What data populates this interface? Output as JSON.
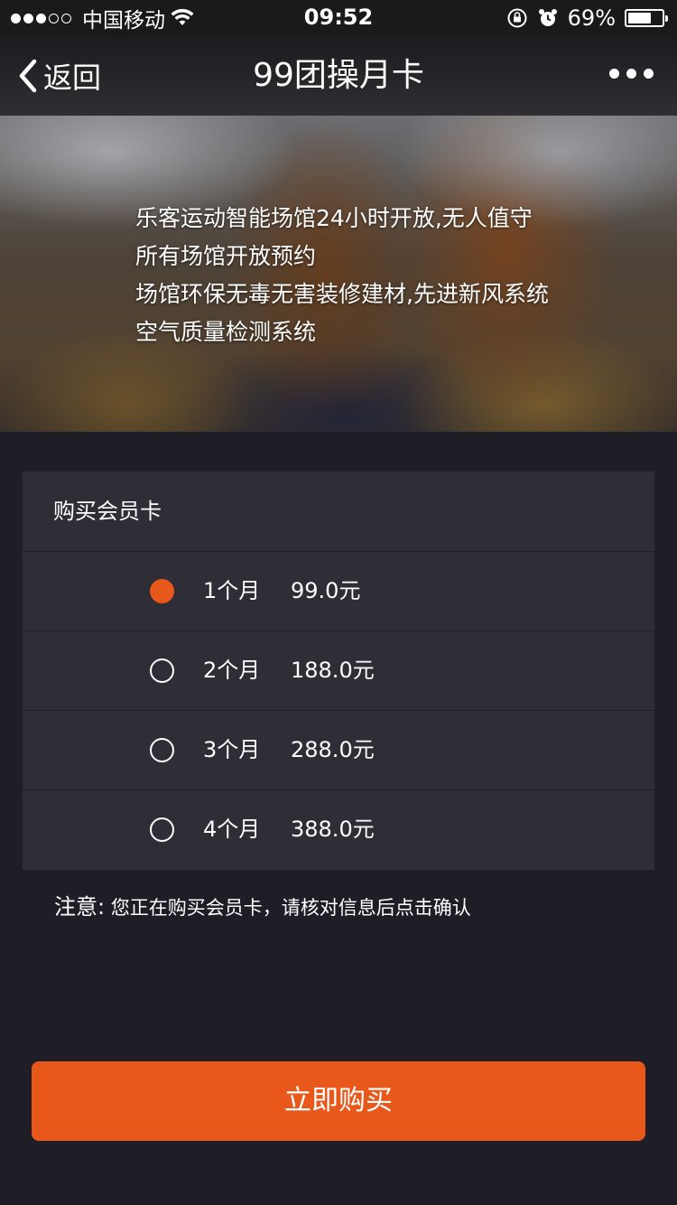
{
  "status_bar": {
    "signal_full": 3,
    "signal_empty": 2,
    "carrier": "中国移动",
    "time": "09:52",
    "battery_percent_text": "69%",
    "battery_level": 0.69
  },
  "nav": {
    "back_label": "返回",
    "title": "99团操月卡"
  },
  "banner": {
    "lines": [
      "乐客运动智能场馆24小时开放,无人值守",
      "所有场馆开放预约",
      "场馆环保无毒无害装修建材,先进新风系统",
      "空气质量检测系统"
    ]
  },
  "purchase": {
    "header": "购买会员卡",
    "options": [
      {
        "duration": "1个月",
        "price": "99.0元",
        "selected": true
      },
      {
        "duration": "2个月",
        "price": "188.0元",
        "selected": false
      },
      {
        "duration": "3个月",
        "price": "288.0元",
        "selected": false
      },
      {
        "duration": "4个月",
        "price": "388.0元",
        "selected": false
      }
    ]
  },
  "notice": {
    "label": "注意:",
    "text": "您正在购买会员卡，请核对信息后点击确认"
  },
  "buy_button_label": "立即购买",
  "colors": {
    "accent": "#e8581b",
    "background": "#1f1e27",
    "panel": "#2f2e36"
  }
}
